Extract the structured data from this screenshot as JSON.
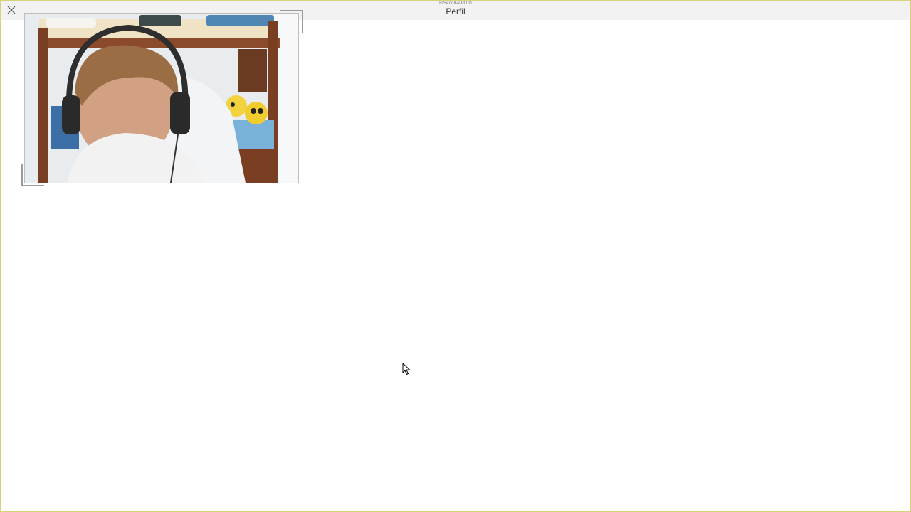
{
  "window": {
    "subtitle": "ElSeñorPAPU:D",
    "title": "Perfil",
    "accent_border_color": "#d8d07a"
  },
  "icons": {
    "close": "close-icon",
    "cursor": "mouse-pointer-icon"
  },
  "webcam": {
    "description_icon": "webcam-video"
  }
}
